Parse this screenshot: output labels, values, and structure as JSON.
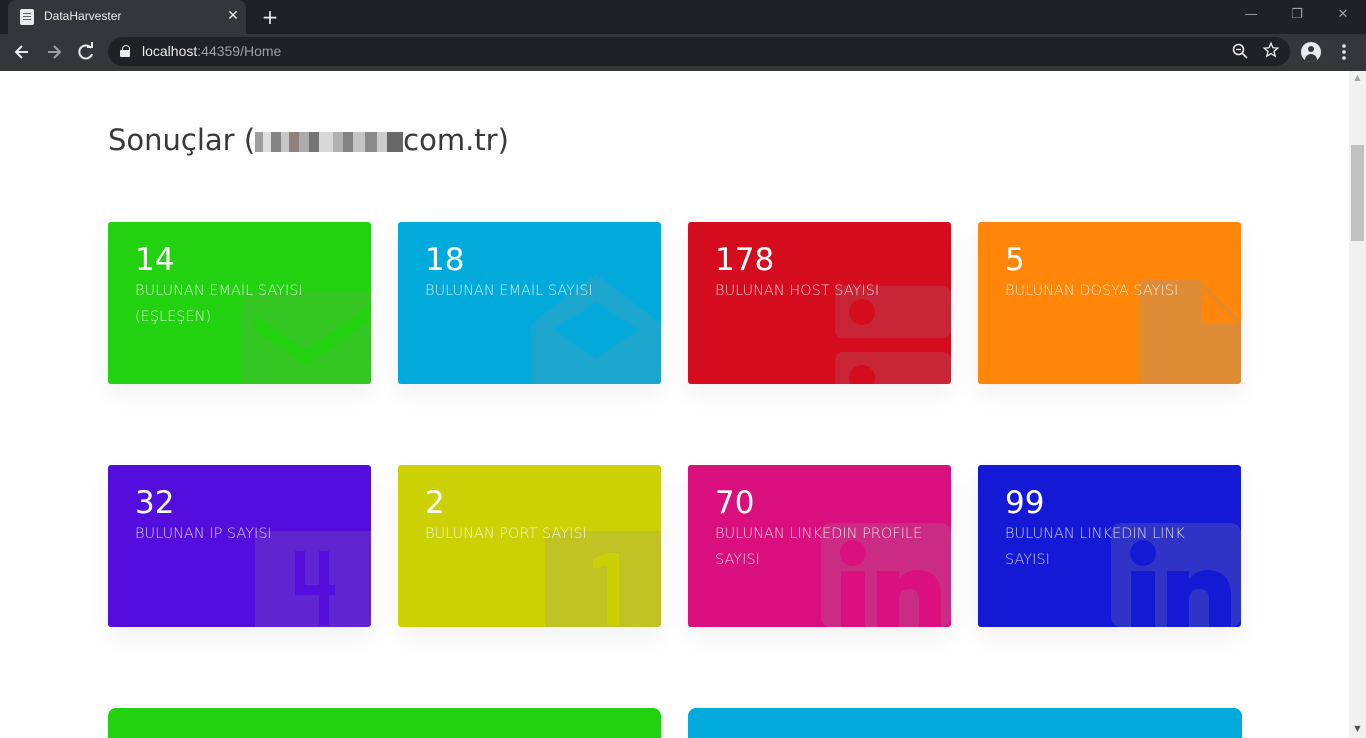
{
  "browser": {
    "tab_title": "DataHarvester",
    "url_host": "localhost",
    "url_rest": ":44359/Home",
    "tab_close": "✕",
    "new_tab": "+",
    "window_minimize": "—",
    "window_restore": "❐",
    "window_close": "✕"
  },
  "page": {
    "title_prefix": "Sonuçlar (",
    "title_suffix": "com.tr)"
  },
  "cards": [
    {
      "value": "14",
      "label": "BULUNAN EMAİL SAYISI (EŞLEŞEN)",
      "color": "#22d10f",
      "icon": "checkmark-icon"
    },
    {
      "value": "18",
      "label": "BULUNAN EMAİL SAYISI",
      "color": "#02aadb",
      "icon": "envelope-icon"
    },
    {
      "value": "178",
      "label": "BULUNAN HOST SAYISI",
      "color": "#d50b1e",
      "icon": "server-icon"
    },
    {
      "value": "5",
      "label": "BULUNAN DOSYA SAYISI",
      "color": "#ff8608",
      "icon": "file-icon"
    },
    {
      "value": "32",
      "label": "BULUNAN IP SAYISI",
      "color": "#530ddd",
      "icon": "ipv4-icon"
    },
    {
      "value": "2",
      "label": "BULUNAN PORT SAYISI",
      "color": "#cbd104",
      "icon": "port-icon"
    },
    {
      "value": "70",
      "label": "BULUNAN LINKEDIN PROFILE SAYISI",
      "color": "#da0f7e",
      "icon": "linkedin-icon"
    },
    {
      "value": "99",
      "label": "BULUNAN LINKEDIN LINK SAYISI",
      "color": "#1319d5",
      "icon": "linkedin-icon"
    }
  ],
  "wide_cards": [
    {
      "color": "#22d10f"
    },
    {
      "color": "#02aadb"
    }
  ]
}
